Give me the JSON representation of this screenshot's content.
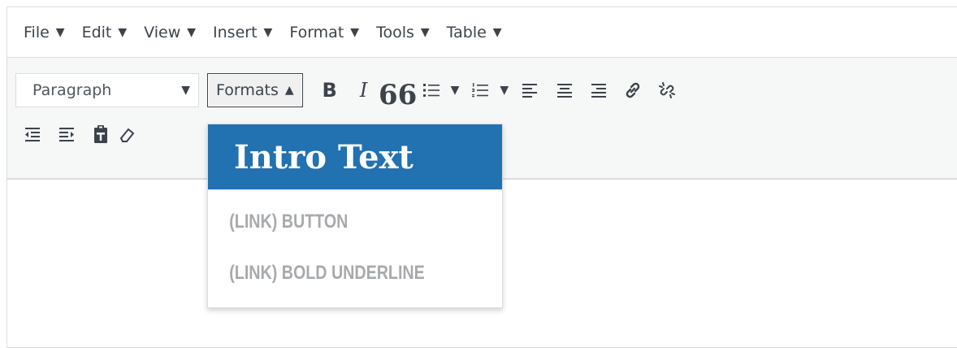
{
  "menubar": {
    "items": [
      "File",
      "Edit",
      "View",
      "Insert",
      "Format",
      "Tools",
      "Table"
    ],
    "caret": "▼"
  },
  "toolbar": {
    "block_select": "Paragraph",
    "block_caret": "▼",
    "formats_label": "Formats",
    "formats_caret": "▲",
    "bold_glyph": "B",
    "italic_glyph": "I",
    "quote_glyph": "66",
    "list_caret": "▼"
  },
  "formats_menu": {
    "items": [
      "Intro Text",
      "(LINK) BUTTON",
      "(LINK) BOLD UNDERLINE"
    ],
    "active_index": 0
  },
  "icons": [
    "bullet-list-icon",
    "numbered-list-icon",
    "align-left-icon",
    "align-center-icon",
    "align-right-icon",
    "link-icon",
    "unlink-icon",
    "outdent-icon",
    "indent-icon",
    "paste-text-icon",
    "eraser-icon",
    "redo-icon"
  ],
  "colors": {
    "accent": "#2271b1",
    "toolbar_bg": "#f6f7f7",
    "border": "#dcdcde",
    "muted_text": "#a7aaad",
    "icon": "#3c434a"
  }
}
